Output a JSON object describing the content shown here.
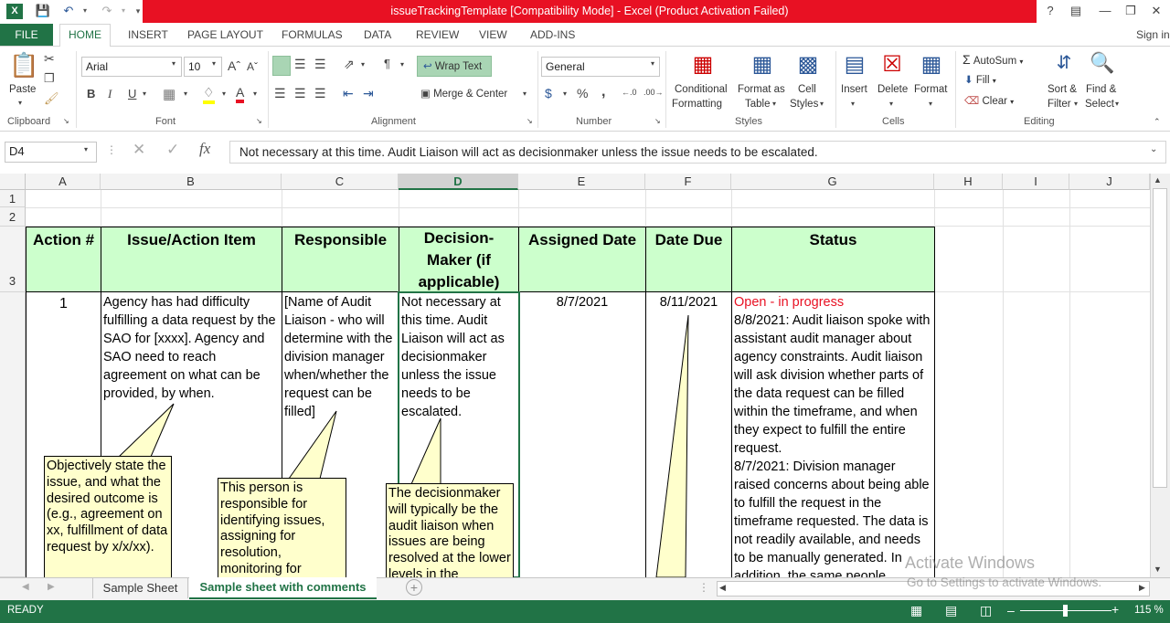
{
  "window": {
    "title": "issueTrackingTemplate  [Compatibility Mode] -  Excel (Product Activation Failed)",
    "help": "?",
    "signin": "Sign in"
  },
  "tabs": [
    "FILE",
    "HOME",
    "INSERT",
    "PAGE LAYOUT",
    "FORMULAS",
    "DATA",
    "REVIEW",
    "VIEW",
    "ADD-INS"
  ],
  "ribbon": {
    "clipboard": {
      "paste": "Paste",
      "label": "Clipboard"
    },
    "font": {
      "name": "Arial",
      "size": "10",
      "bold": "B",
      "italic": "I",
      "underline": "U",
      "label": "Font"
    },
    "alignment": {
      "wrap": "Wrap Text",
      "merge": "Merge & Center",
      "label": "Alignment"
    },
    "number": {
      "format": "General",
      "percent": "%",
      "comma": ",",
      "label": "Number"
    },
    "styles": {
      "conditional1": "Conditional",
      "conditional2": "Formatting",
      "format_table1": "Format as",
      "format_table2": "Table",
      "cell_styles1": "Cell",
      "cell_styles2": "Styles",
      "label": "Styles"
    },
    "cells": {
      "insert": "Insert",
      "delete": "Delete",
      "format": "Format",
      "label": "Cells"
    },
    "editing": {
      "autosum": "AutoSum",
      "fill": "Fill",
      "clear": "Clear",
      "sort1": "Sort &",
      "sort2": "Filter",
      "find1": "Find &",
      "find2": "Select",
      "label": "Editing"
    }
  },
  "formula_bar": {
    "name_box": "D4",
    "fx": "fx",
    "content": "Not necessary at this time.  Audit Liaison will act as decisionmaker unless the issue needs to be escalated."
  },
  "columns": [
    "A",
    "B",
    "C",
    "D",
    "E",
    "F",
    "G",
    "H",
    "I",
    "J"
  ],
  "rows": [
    "1",
    "2",
    "3"
  ],
  "headers": [
    "Action #",
    "Issue/Action Item",
    "Responsible",
    "Decision-Maker (if applicable)",
    "Assigned Date",
    "Date Due",
    "Status"
  ],
  "row4": {
    "action": "1",
    "issue": "Agency has had difficulty fulfilling a data request by the SAO for [xxxx].  Agency and SAO need to reach agreement on what can be provided, by when.",
    "responsible": "[Name of Audit Liaison - who will determine with the division manager when/whether the request can be filled]",
    "decision": "Not necessary at this time.  Audit Liaison will act as decisionmaker unless the issue needs to be escalated.",
    "assigned": "8/7/2021",
    "due": "8/11/2021",
    "status_head": "Open - in progress",
    "status_body": "8/8/2021:  Audit liaison spoke with assistant audit manager about agency constraints.  Audit liaison will ask division whether parts of the data request can be filled within the timeframe, and when they expect to fulfill the entire request.\n8/7/2021:  Division manager raised concerns about being able to fulfill the request in the timeframe requested.  The data is not readily available, and needs to be manually generated.  In addition, the same people"
  },
  "callouts": {
    "issue": "Objectively state the issue, and what the desired outcome is (e.g., agreement on xx, fulfillment of data request by x/x/xx).",
    "responsible": "This person is responsible for identifying issues, assigning for resolution, monitoring for",
    "decision": "The decisionmaker will typically be the audit liaison when issues are being resolved at the lower levels in the"
  },
  "sheets": [
    "Sample Sheet",
    "Sample sheet with comments"
  ],
  "watermark": {
    "line1": "Activate Windows",
    "line2": "Go to Settings to activate Windows."
  },
  "status": {
    "ready": "READY",
    "zoom": "115 %"
  },
  "colors": {
    "excel_green": "#217346",
    "title_red": "#e81123",
    "header_fill": "#ccffcc",
    "callout_fill": "#ffffcc",
    "status_red": "#e81123"
  }
}
